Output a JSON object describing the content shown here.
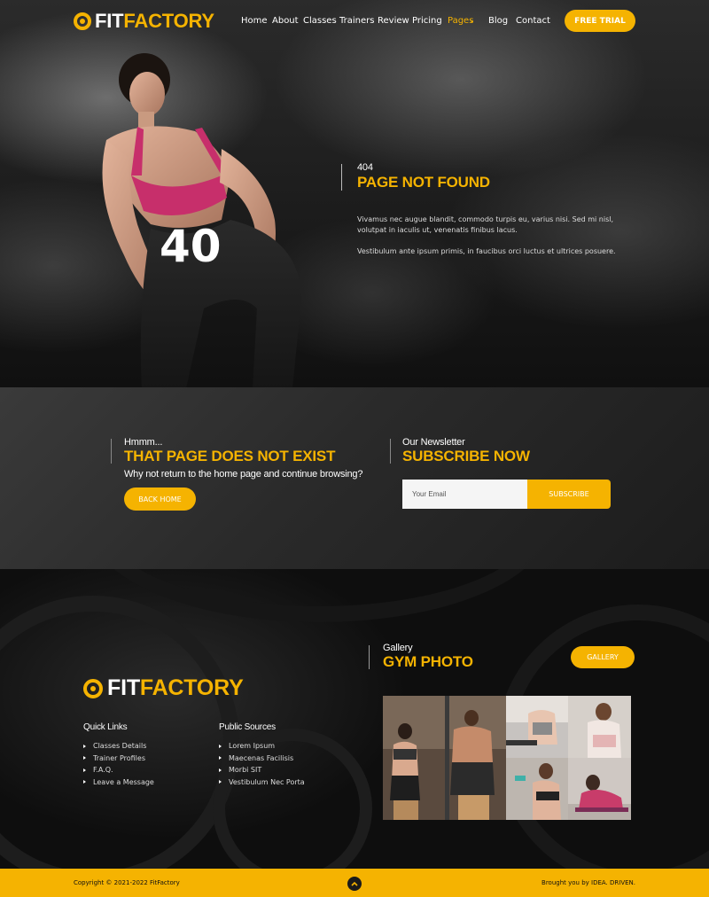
{
  "brand": {
    "fit": "FIT",
    "factory": "FACTORY"
  },
  "nav": {
    "items": [
      "Home",
      "About",
      "Classes",
      "Trainers",
      "Review",
      "Pricing",
      "Pages",
      "Blog",
      "Contact"
    ],
    "active": "Pages",
    "cta": "FREE TRIAL"
  },
  "hero": {
    "code": "404",
    "title": "PAGE NOT FOUND",
    "p1": "Vivamus nec augue blandit, commodo turpis eu, varius nisi. Sed mi nisl, volutpat in iaculis ut, venenatis finibus lacus.",
    "p2": "Vestibulum ante ipsum primis, in faucibus orci luctus et ultrices posuere.",
    "watermark": "40"
  },
  "notice": {
    "small": "Hmmm...",
    "title": "THAT PAGE DOES NOT EXIST",
    "subtitle": "Why not return to the home page and continue browsing?",
    "button": "BACK HOME"
  },
  "newsletter": {
    "small": "Our Newsletter",
    "title": "SUBSCRIBE NOW",
    "placeholder": "Your Email",
    "button": "SUBSCRIBE"
  },
  "footer": {
    "quick_links": {
      "title": "Quick Links",
      "items": [
        "Classes Details",
        "Trainer Profiles",
        "F.A.Q.",
        "Leave a Message"
      ]
    },
    "public_sources": {
      "title": "Public Sources",
      "items": [
        "Lorem Ipsum",
        "Maecenas Facilisis",
        "Morbi SIT",
        "Vestibulum Nec Porta"
      ]
    },
    "gallery": {
      "small": "Gallery",
      "title": "GYM PHOTO",
      "button": "GALLERY"
    }
  },
  "bottom": {
    "copyright": "Copyright © 2021-2022 FitFactory",
    "credit": "Brought you by IDEA. DRIVEN."
  },
  "colors": {
    "accent": "#f5b301",
    "dark": "#111111"
  }
}
